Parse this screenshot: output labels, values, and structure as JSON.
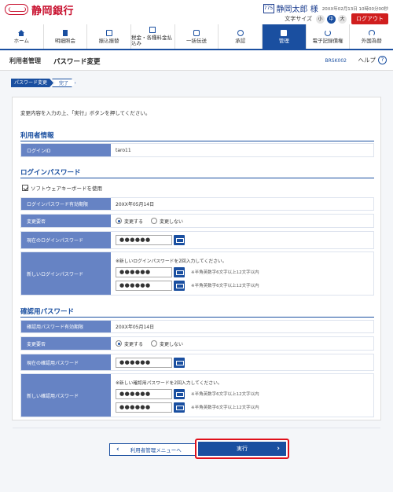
{
  "header": {
    "bank_name": "静岡銀行",
    "user_badge": "775",
    "user_name": "静岡太郎 様",
    "login_time": "20XX年02月13日 10時00分00秒",
    "font_size_label": "文字サイズ",
    "font_sizes": [
      "小",
      "中",
      "大"
    ],
    "logout_label": "ログアウト"
  },
  "gnav": [
    {
      "label": "ホーム",
      "icon": "home-icon"
    },
    {
      "label": "明細照会",
      "icon": "document-icon"
    },
    {
      "label": "振込振替",
      "icon": "transfer-icon"
    },
    {
      "label": "税金・各種料金払込み",
      "icon": "bill-icon"
    },
    {
      "label": "一括伝送",
      "icon": "bulk-icon"
    },
    {
      "label": "承認",
      "icon": "approve-icon"
    },
    {
      "label": "管理",
      "icon": "admin-icon",
      "active": true
    },
    {
      "label": "電子記録債権",
      "icon": "cycle-icon"
    },
    {
      "label": "外国為替",
      "icon": "dollar-icon"
    }
  ],
  "subheader": {
    "category": "利用者管理",
    "title": "パスワード変更",
    "screen_id": "BRSK002",
    "help_label": "ヘルプ",
    "help_icon": "?"
  },
  "steps": [
    "パスワード変更",
    "完了"
  ],
  "intro": "変更内容を入力の上、「実行」ボタンを押してください。",
  "user_info": {
    "title": "利用者情報",
    "login_id_label": "ログインID",
    "login_id_value": "taro11"
  },
  "login_password": {
    "title": "ログインパスワード",
    "software_keyboard": "ソフトウェアキーボードを使用",
    "expiry_label": "ログインパスワード有効期限",
    "expiry_value": "20XX年05月14日",
    "change_label": "変更要否",
    "change_yes": "変更する",
    "change_no": "変更しない",
    "current_label": "現在のログインパスワード",
    "current_value": "●●●●●●",
    "new_label": "新しいログインパスワード",
    "new_note": "※新しいログインパスワードを2回入力してください。",
    "new_value1": "●●●●●●",
    "new_value2": "●●●●●●",
    "hint": "※半角英数字6文字以上12文字以内"
  },
  "confirm_password": {
    "title": "確認用パスワード",
    "expiry_label": "確認用パスワード有効期限",
    "expiry_value": "20XX年05月14日",
    "change_label": "変更要否",
    "change_yes": "変更する",
    "change_no": "変更しない",
    "current_label": "現在の確認用パスワード",
    "current_value": "●●●●●●",
    "new_label": "新しい確認用パスワード",
    "new_note": "※新しい確認用パスワードを2回入力してください。",
    "new_value1": "●●●●●●",
    "new_value2": "●●●●●●",
    "hint": "※半角英数字6文字以上12文字以内"
  },
  "buttons": {
    "back": "利用者管理メニューへ",
    "execute": "実行"
  },
  "colors": {
    "brand_red": "#c8102e",
    "primary_blue": "#1a4fa0",
    "label_blue": "#6683c4",
    "highlight_red": "#e0101a"
  }
}
